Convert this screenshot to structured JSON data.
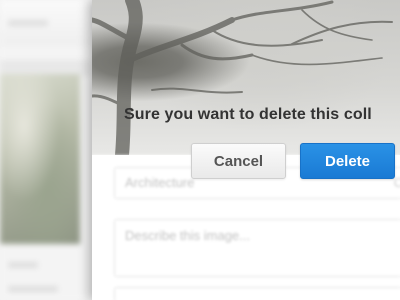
{
  "dialog": {
    "message": "Sure you want to delete this coll",
    "cancel_label": "Cancel",
    "delete_label": "Delete",
    "delete_color": "#1a82dc"
  },
  "form": {
    "tag_value": "Architecture",
    "tag_suffix": "C",
    "description_placeholder": "Describe this image..."
  }
}
